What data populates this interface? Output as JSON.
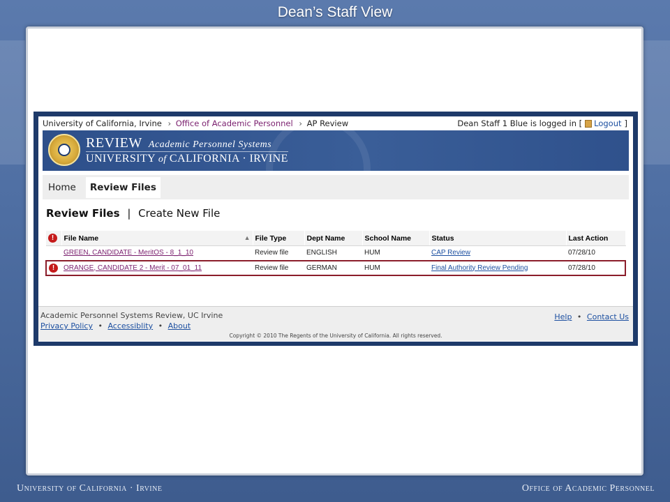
{
  "slide": {
    "title": "Dean’s Staff View",
    "footer_left": "University of California · Irvine",
    "footer_right": "Office of Academic Personnel"
  },
  "breadcrumb": {
    "root": "University of California, Irvine",
    "sep": "›",
    "middle": "Office of Academic Personnel",
    "current": "AP Review"
  },
  "login": {
    "text": "Dean Staff 1 Blue is logged in [",
    "logout_label": "Logout",
    "close_bracket": "]"
  },
  "banner": {
    "title": "REVIEW",
    "title_small": "Academic Personnel Systems",
    "subtitle_a": "UNIVERSITY",
    "subtitle_of": "of",
    "subtitle_b": "CALIFORNIA · IRVINE"
  },
  "nav": {
    "home": "Home",
    "review_files": "Review Files"
  },
  "heading": {
    "review_files": "Review Files",
    "separator": "|",
    "create_new": "Create New File"
  },
  "table": {
    "columns": [
      "File Name",
      "File Type",
      "Dept Name",
      "School Name",
      "Status",
      "Last Action"
    ],
    "rows": [
      {
        "file_name": "GREEN, CANDIDATE - MeritOS - 8_1_10",
        "file_type": "Review file",
        "dept": "ENGLISH",
        "school": "HUM",
        "status": "CAP Review",
        "last_action": "07/28/10"
      },
      {
        "file_name": "ORANGE, CANDIDATE 2 - Merit - 07_01_11",
        "file_type": "Review file",
        "dept": "GERMAN",
        "school": "HUM",
        "status": "Final Authority Review Pending",
        "last_action": "07/28/10"
      }
    ],
    "alert_glyph": "!",
    "sort_glyph": "▲"
  },
  "footer": {
    "site": "Academic Personnel Systems Review, UC Irvine",
    "privacy": "Privacy Policy",
    "accessibility": "Accessiblity",
    "about": "About",
    "dot": "•",
    "help": "Help",
    "contact": "Contact Us",
    "copyright": "Copyright © 2010 The Regents of the University of California. All rights reserved."
  },
  "colors": {
    "link_purple": "#7a1f6e",
    "link_blue": "#1c4fa0",
    "highlight_border": "#8b1d2a",
    "alert_red": "#c51a1a",
    "banner_blue": "#2d4f8a"
  }
}
